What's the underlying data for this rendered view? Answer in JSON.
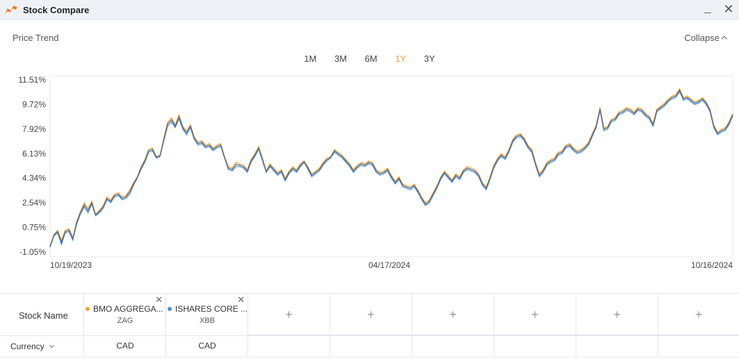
{
  "window": {
    "title": "Stock Compare"
  },
  "section": {
    "title": "Price Trend",
    "collapse_label": "Collapse"
  },
  "periods": [
    {
      "label": "1M",
      "active": false
    },
    {
      "label": "3M",
      "active": false
    },
    {
      "label": "6M",
      "active": false
    },
    {
      "label": "1Y",
      "active": true
    },
    {
      "label": "3Y",
      "active": false
    }
  ],
  "colors": {
    "accent": "#e8a33c",
    "series1": "#f0a640",
    "series2": "#4a90d9",
    "line": "#5a6a7a"
  },
  "chart_data": {
    "type": "line",
    "yticks": [
      "11.51%",
      "9.72%",
      "7.92%",
      "6.13%",
      "4.34%",
      "2.54%",
      "0.75%",
      "-1.05%"
    ],
    "ylim": [
      -1.05,
      11.51
    ],
    "xticks": [
      "10/19/2023",
      "04/17/2024",
      "10/16/2024"
    ],
    "series": [
      {
        "name": "BMO AGGREGA...",
        "color": "#f0a640",
        "values": [
          -0.2,
          0.6,
          0.9,
          0.2,
          0.9,
          1.0,
          0.4,
          1.5,
          2.2,
          2.8,
          2.4,
          2.9,
          2.0,
          2.3,
          2.6,
          3.2,
          3.0,
          3.4,
          3.5,
          3.2,
          3.3,
          3.7,
          4.2,
          4.6,
          5.3,
          5.8,
          6.5,
          6.6,
          6.0,
          6.1,
          7.3,
          8.4,
          8.7,
          8.2,
          8.9,
          8.1,
          7.8,
          8.2,
          7.4,
          7.0,
          7.1,
          6.8,
          6.9,
          6.6,
          6.8,
          6.9,
          6.0,
          5.3,
          5.2,
          5.6,
          5.5,
          5.4,
          5.1,
          5.8,
          6.2,
          6.7,
          5.9,
          5.0,
          5.5,
          5.2,
          4.9,
          5.1,
          4.5,
          5.0,
          5.3,
          5.1,
          5.5,
          5.7,
          5.3,
          4.8,
          5.0,
          5.2,
          5.6,
          5.9,
          6.0,
          6.5,
          6.3,
          6.1,
          5.8,
          5.5,
          5.1,
          5.4,
          5.6,
          5.5,
          5.7,
          5.6,
          5.1,
          4.9,
          5.0,
          5.2,
          4.7,
          4.3,
          4.6,
          4.1,
          4.0,
          3.9,
          4.1,
          3.7,
          3.2,
          2.8,
          3.0,
          3.5,
          4.0,
          4.6,
          5.0,
          4.7,
          4.4,
          4.8,
          4.6,
          5.1,
          5.3,
          5.2,
          5.1,
          4.8,
          4.2,
          3.9,
          4.6,
          5.4,
          5.9,
          6.2,
          6.0,
          6.5,
          7.2,
          7.5,
          7.6,
          7.3,
          6.8,
          6.5,
          5.6,
          4.8,
          5.1,
          5.6,
          5.8,
          5.9,
          6.3,
          6.4,
          6.8,
          6.9,
          6.6,
          6.4,
          6.5,
          6.7,
          7.0,
          7.6,
          8.2,
          9.4,
          8.0,
          8.1,
          8.6,
          8.7,
          9.1,
          9.2,
          9.4,
          9.3,
          9.1,
          9.4,
          9.3,
          9.0,
          8.8,
          8.3,
          9.3,
          9.5,
          9.7,
          10.0,
          10.2,
          10.3,
          10.7,
          10.1,
          10.2,
          10.0,
          9.8,
          9.9,
          10.1,
          9.8,
          9.3,
          8.2,
          7.7,
          7.9,
          8.0,
          8.4,
          9.0
        ]
      },
      {
        "name": "ISHARES CORE ...",
        "color": "#4a90d9",
        "values": [
          -0.3,
          0.5,
          0.7,
          -0.1,
          0.7,
          0.8,
          0.2,
          1.3,
          2.0,
          2.5,
          2.1,
          2.7,
          1.9,
          2.1,
          2.4,
          3.0,
          2.8,
          3.2,
          3.3,
          3.0,
          3.1,
          3.4,
          4.0,
          4.5,
          5.1,
          5.6,
          6.3,
          6.4,
          5.9,
          6.0,
          7.1,
          8.1,
          8.4,
          8.0,
          8.6,
          7.9,
          7.5,
          8.0,
          7.2,
          6.8,
          6.9,
          6.6,
          6.7,
          6.4,
          6.6,
          6.7,
          5.9,
          5.1,
          5.0,
          5.3,
          5.3,
          5.2,
          4.9,
          5.6,
          6.0,
          6.5,
          5.7,
          4.9,
          5.3,
          5.0,
          4.7,
          4.9,
          4.3,
          4.8,
          5.1,
          4.9,
          5.3,
          5.6,
          5.1,
          4.6,
          4.8,
          5.0,
          5.4,
          5.7,
          5.9,
          6.3,
          6.1,
          5.9,
          5.6,
          5.3,
          4.9,
          5.2,
          5.4,
          5.3,
          5.5,
          5.4,
          4.9,
          4.7,
          4.8,
          5.0,
          4.5,
          4.1,
          4.4,
          3.9,
          3.8,
          3.7,
          3.9,
          3.5,
          3.0,
          2.6,
          2.8,
          3.3,
          3.8,
          4.4,
          4.8,
          4.5,
          4.2,
          4.6,
          4.4,
          4.9,
          5.1,
          5.0,
          4.9,
          4.6,
          4.0,
          3.7,
          4.4,
          5.2,
          5.7,
          6.0,
          5.8,
          6.3,
          7.0,
          7.3,
          7.4,
          7.1,
          6.6,
          6.3,
          5.4,
          4.6,
          4.9,
          5.4,
          5.6,
          5.7,
          6.1,
          6.2,
          6.6,
          6.7,
          6.4,
          6.2,
          6.3,
          6.5,
          6.8,
          7.4,
          8.0,
          9.2,
          7.8,
          7.9,
          8.4,
          8.5,
          8.9,
          9.0,
          9.2,
          9.1,
          8.9,
          9.2,
          9.1,
          8.8,
          8.6,
          8.1,
          9.1,
          9.3,
          9.5,
          9.8,
          10.0,
          10.1,
          10.5,
          9.9,
          10.0,
          9.8,
          9.6,
          9.7,
          9.9,
          9.6,
          9.1,
          8.0,
          7.5,
          7.7,
          7.8,
          8.2,
          8.8
        ]
      }
    ]
  },
  "table": {
    "stock_name_label": "Stock Name",
    "currency_label": "Currency",
    "stocks": [
      {
        "name": "BMO AGGREGA...",
        "ticker": "ZAG",
        "currency": "CAD"
      },
      {
        "name": "ISHARES CORE ...",
        "ticker": "XBB",
        "currency": "CAD"
      }
    ],
    "add_symbol": "+",
    "remove_symbol": "✕"
  }
}
